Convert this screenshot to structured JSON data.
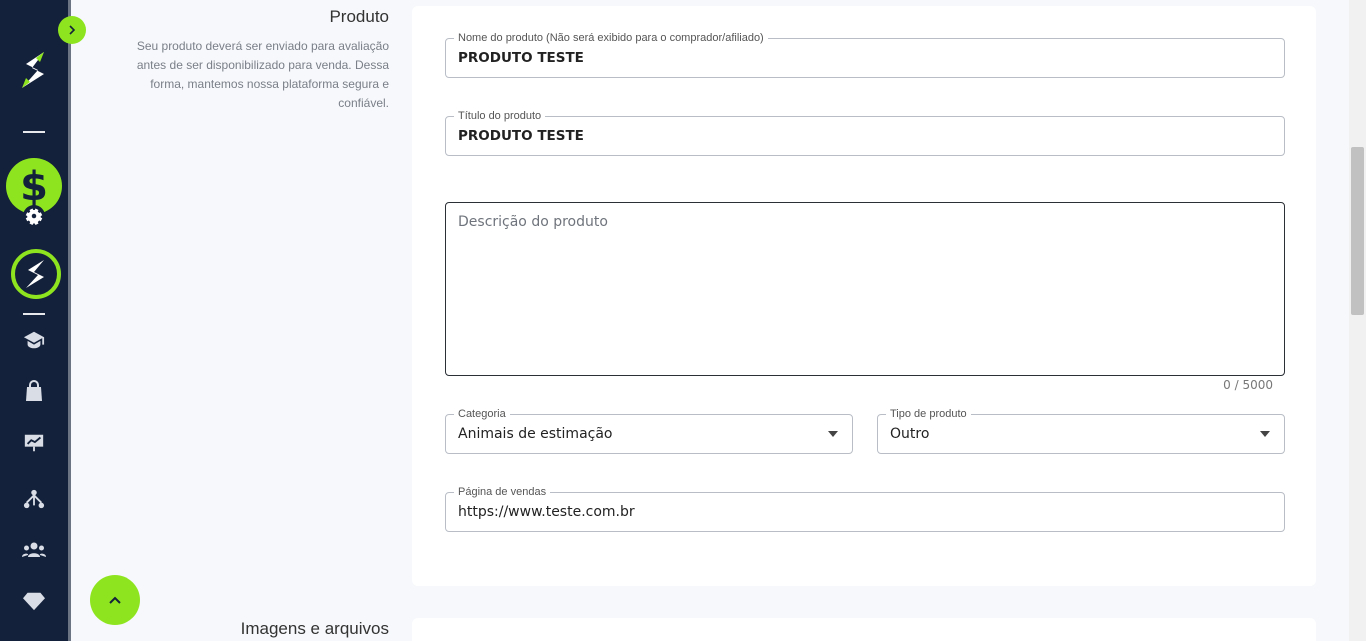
{
  "sidebar": {
    "icons": [
      "logo-icon",
      "dollar-icon",
      "gear-icon",
      "brand-ring-icon",
      "graduation-cap-icon",
      "shopping-bag-icon",
      "presentation-chart-icon",
      "network-icon",
      "users-icon",
      "diamond-icon"
    ],
    "colors": {
      "background": "#14213a",
      "accent": "#8ee51f"
    }
  },
  "product_section": {
    "title": "Produto",
    "description": "Seu produto deverá ser enviado para avaliação antes de ser disponibilizado para venda. Dessa forma, mantemos nossa plataforma segura e confiável."
  },
  "form": {
    "product_name": {
      "label": "Nome do produto (Não será exibido para o comprador/afiliado)",
      "value": "PRODUTO TESTE"
    },
    "product_title": {
      "label": "Título do produto",
      "value": "PRODUTO TESTE"
    },
    "description": {
      "placeholder": "Descrição do produto",
      "counter": "0 / 5000"
    },
    "category": {
      "label": "Categoria",
      "value": "Animais de estimação"
    },
    "product_type": {
      "label": "Tipo de produto",
      "value": "Outro"
    },
    "sales_page": {
      "label": "Página de vendas",
      "value": "https://www.teste.com.br"
    }
  },
  "files_section": {
    "title": "Imagens e arquivos"
  }
}
